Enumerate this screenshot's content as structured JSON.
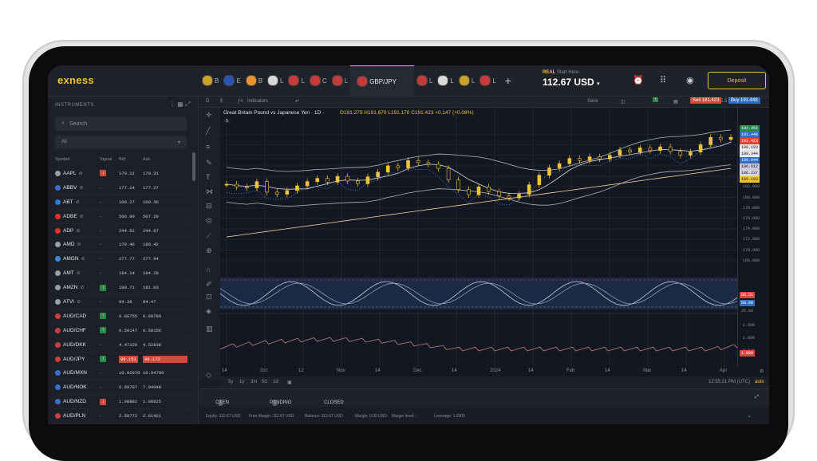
{
  "app": {
    "logo": "exness"
  },
  "tabs": [
    {
      "name": "B"
    },
    {
      "name": "E"
    },
    {
      "name": "B"
    },
    {
      "name": "L"
    },
    {
      "name": "L"
    },
    {
      "name": "C"
    },
    {
      "name": "L"
    },
    {
      "name": "GBP/JPY",
      "active": true
    },
    {
      "name": "L"
    },
    {
      "name": "L"
    },
    {
      "name": "L"
    },
    {
      "name": "L"
    }
  ],
  "account": {
    "type": "REAL",
    "hint": "Start Here",
    "balance": "112.67 USD",
    "deposit_label": "Deposit"
  },
  "sidebar": {
    "title": "INSTRUMENTS",
    "search_placeholder": "Search",
    "filter": "All",
    "headers": {
      "symbol": "Symbol",
      "signal": "Signal",
      "bid": "Bid",
      "ask": "Ask"
    },
    "rows": [
      {
        "symbol": "AAPL",
        "signal": "down",
        "bid": "170.11",
        "ask": "170.31",
        "color": "#9aa0aa"
      },
      {
        "symbol": "ABBV",
        "signal": "-",
        "bid": "177.14",
        "ask": "177.27",
        "color": "#3a6fd0"
      },
      {
        "symbol": "ABT",
        "signal": "-",
        "bid": "109.27",
        "ask": "109.36",
        "color": "#2f79d8"
      },
      {
        "symbol": "ADBE",
        "signal": "-",
        "bid": "506.90",
        "ask": "507.29",
        "color": "#e0322b"
      },
      {
        "symbol": "ADP",
        "signal": "-",
        "bid": "244.52",
        "ask": "244.67",
        "color": "#e0322b"
      },
      {
        "symbol": "AMD",
        "signal": "-",
        "bid": "179.46",
        "ask": "180.42",
        "color": "#9aa0aa"
      },
      {
        "symbol": "AMGN",
        "signal": "-",
        "bid": "277.77",
        "ask": "277.94",
        "color": "#3a8ad8"
      },
      {
        "symbol": "AMT",
        "signal": "-",
        "bid": "194.14",
        "ask": "194.28",
        "color": "#9aa0aa"
      },
      {
        "symbol": "AMZN",
        "signal": "up",
        "bid": "180.71",
        "ask": "181.03",
        "color": "#9aa0aa"
      },
      {
        "symbol": "ATVI",
        "signal": "-",
        "bid": "94.38",
        "ask": "94.47",
        "color": "#9aa0aa"
      },
      {
        "symbol": "AUD/CAD",
        "signal": "up",
        "bid": "0.88755",
        "ask": "0.88780",
        "color": "#c84040"
      },
      {
        "symbol": "AUD/CHF",
        "signal": "up",
        "bid": "0.59147",
        "ask": "0.59156",
        "color": "#c84040"
      },
      {
        "symbol": "AUD/DKK",
        "signal": "-",
        "bid": "4.47120",
        "ask": "4.52838",
        "color": "#c84040"
      },
      {
        "symbol": "AUD/JPY",
        "signal": "up",
        "bid": "99.151",
        "ask": "99.172",
        "color": "#c84040",
        "highlight": true
      },
      {
        "symbol": "AUD/MXN",
        "signal": "-",
        "bid": "10.92970",
        "ask": "10.94700",
        "color": "#3a6fd0"
      },
      {
        "symbol": "AUD/NOK",
        "signal": "-",
        "bid": "6.99797",
        "ask": "7.04048",
        "color": "#3a6fd0"
      },
      {
        "symbol": "AUD/NZD",
        "signal": "down",
        "bid": "1.08882",
        "ask": "1.08825",
        "color": "#3a6fd0"
      },
      {
        "symbol": "AUD/PLN",
        "signal": "-",
        "bid": "2.58772",
        "ask": "2.61421",
        "color": "#c84040"
      },
      {
        "symbol": "AUD/SEK",
        "signal": "-",
        "bid": "6.88218",
        "ask": "6.93519",
        "color": "#3a6fd0"
      }
    ]
  },
  "toolbar": {
    "d_label": "D",
    "indicators_label": "Indicators",
    "save_label": "Save",
    "sell_label": "Sell 191.423",
    "spread": "2.5",
    "buy_label": "Buy 191.448"
  },
  "chart": {
    "title": "Great Britain Pound vs Japanese Yen · 1D ·",
    "ohlc": "O191.279 H191.670 L191.170 C191.423 +0.147 (+0.08%)",
    "sub_legend": "5",
    "time_label": "12:55:21 PM (UTC)",
    "auto_label": "auto",
    "timeframes": [
      "5y",
      "1y",
      "3m",
      "5d",
      "1d"
    ],
    "colors": {
      "candle": "#f0c33c",
      "ma1": "#f0d9a0",
      "ma2": "#d8d8d8",
      "band": "#b0b4bc",
      "sar": "#4a8fe0",
      "stoch": "#c8ccd4",
      "macd": "#c08080"
    }
  },
  "chart_data": {
    "type": "line",
    "title": "Great Britain Pound vs Japanese Yen · 1D ·",
    "xlabel": "",
    "ylabel": "",
    "ylim": [
      166,
      194
    ],
    "y_ticks": [
      "192.000",
      "190.000",
      "188.000",
      "186.000",
      "184.000",
      "182.000",
      "180.000",
      "178.000",
      "176.000",
      "174.000",
      "172.000",
      "170.000",
      "168.000"
    ],
    "x_ticks": [
      "14",
      "Oct",
      "12",
      "Nov",
      "14",
      "Dec",
      "14",
      "2024",
      "14",
      "Feb",
      "14",
      "Mar",
      "14",
      "Apr"
    ],
    "price_tags": [
      {
        "value": "192.451",
        "color": "#2a8a4a"
      },
      {
        "value": "191.448",
        "color": "#2e6fc2"
      },
      {
        "value": "191.423",
        "color": "#d24a3a"
      },
      {
        "value": "190.193",
        "color": "#e8e8e8"
      },
      {
        "value": "189.344",
        "color": "#e8e8e8"
      },
      {
        "value": "189.044",
        "color": "#2e6fc2"
      },
      {
        "value": "186.612",
        "color": "#c8c8d8"
      },
      {
        "value": "186.237",
        "color": "#d8d8d8"
      },
      {
        "value": "185.193",
        "color": "#f0c33c"
      }
    ],
    "series": [
      {
        "values": [
          182.5,
          182.0,
          181.8,
          183.0,
          181.0,
          180.6,
          181.3,
          182.2,
          183.0,
          183.6,
          182.9,
          184.0,
          183.1,
          182.6,
          183.9,
          184.8,
          186.0,
          185.6,
          187.0,
          186.6,
          186.3,
          185.5,
          183.3,
          181.5,
          180.5,
          182.0,
          181.1,
          180.3,
          179.9,
          180.6,
          182.4,
          184.2,
          185.6,
          186.4,
          187.4,
          187.0,
          187.7,
          187.3,
          188.0,
          189.0,
          188.6,
          189.4,
          188.9,
          189.6,
          188.7,
          188.0,
          188.6,
          190.0,
          191.4,
          191.0,
          191.4
        ]
      }
    ],
    "stoch": {
      "levels": [
        "68.51",
        "58.80",
        "25.00"
      ],
      "level_colors": [
        "#d24a3a",
        "#2e6fc2",
        "#8b8f98"
      ]
    },
    "macd": {
      "ticks": [
        "1.500",
        "1.000",
        "0.500"
      ],
      "last": "1.089"
    }
  },
  "bottom": {
    "tabs": [
      {
        "label": "OPEN",
        "count": "1"
      },
      {
        "label": "PENDING",
        "count": "0"
      },
      {
        "label": "CLOSED"
      }
    ],
    "status": {
      "equity": "Equity: 112.67 USD",
      "free_margin": "Free Margin: 112.67 USD",
      "balance": "Balance: 112.67 USD",
      "margin": "Margin: 0.00 USD",
      "margin_level": "Margin level: -",
      "leverage": "Leverage: 1:2000"
    }
  }
}
